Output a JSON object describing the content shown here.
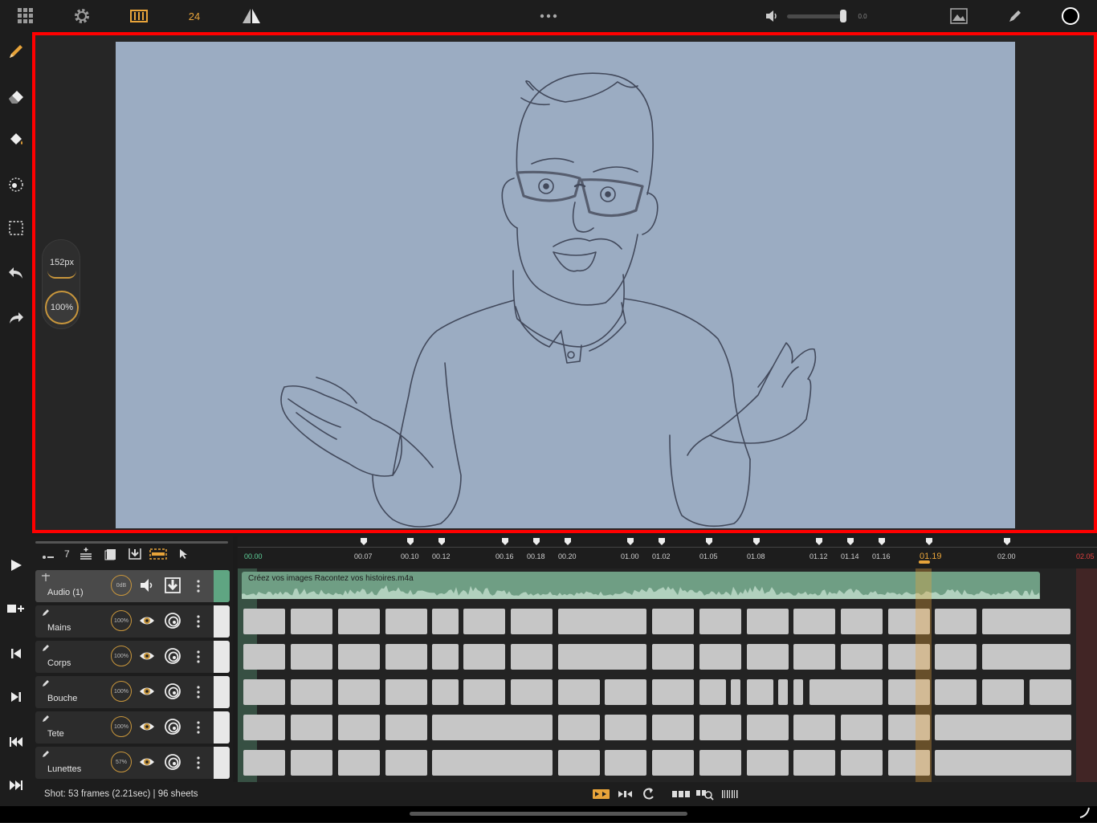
{
  "topbar": {
    "fps": "24",
    "volume_value": "0.0",
    "more_icon": "ellipsis-icon"
  },
  "brush": {
    "size": "152px",
    "opacity": "100%"
  },
  "layer_toolbar": {
    "layer_count": "7"
  },
  "layers": [
    {
      "name": "Audio (1)",
      "level": "0dB",
      "type": "audio"
    },
    {
      "name": "Mains",
      "level": "100%",
      "type": "draw"
    },
    {
      "name": "Corps",
      "level": "100%",
      "type": "draw"
    },
    {
      "name": "Bouche",
      "level": "100%",
      "type": "draw"
    },
    {
      "name": "Tete",
      "level": "100%",
      "type": "draw"
    },
    {
      "name": "Lunettes",
      "level": "57%",
      "type": "draw"
    }
  ],
  "audio_clip": {
    "filename": "Créez vos images Racontez vos histoires.m4a"
  },
  "ruler": {
    "ticks": [
      "00.00",
      "00.07",
      "00.10",
      "00.12",
      "00.16",
      "00.18",
      "00.20",
      "01.00",
      "01.02",
      "01.05",
      "01.08",
      "01.12",
      "01.14",
      "01.16",
      "01.19",
      "02.00",
      "02.05"
    ],
    "current": "01.19"
  },
  "status": {
    "text": "Shot: 53 frames (2.21sec) | 96 sheets"
  },
  "colors": {
    "canvas_bg": "#9bacc2",
    "accent_orange": "#e8a43a",
    "audio_green": "#5fa582",
    "start_green": "#5fd19a",
    "end_red": "#e04040",
    "stage_border": "#ff0000"
  }
}
